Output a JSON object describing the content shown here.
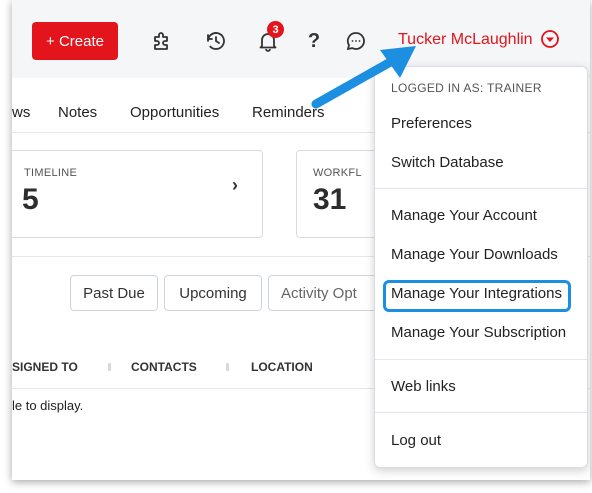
{
  "topbar": {
    "create_label": "+ Create",
    "icons": [
      "puzzle-icon",
      "history-icon",
      "bell-icon",
      "help-icon",
      "chat-icon"
    ],
    "notification_count": "3",
    "help_glyph": "?",
    "user_name": "Tucker McLaughlin",
    "accent_color": "#e3141b"
  },
  "tabs": [
    "ws",
    "Notes",
    "Opportunities",
    "Reminders"
  ],
  "cards": [
    {
      "label": "TIMELINE",
      "value": "5",
      "arrow": "›"
    },
    {
      "label": "WORKFL",
      "value": "31"
    }
  ],
  "filters": [
    "Past Due",
    "Upcoming",
    "Activity Opt"
  ],
  "table": {
    "columns": [
      "SIGNED TO",
      "CONTACTS",
      "LOCATION"
    ],
    "empty_message": "le to display."
  },
  "user_menu": {
    "heading": "LOGGED IN AS: TRAINER",
    "items": [
      "Preferences",
      "Switch Database",
      "Manage Your Account",
      "Manage Your Downloads",
      "Manage Your Integrations",
      "Manage Your Subscription",
      "Web links",
      "Log out"
    ],
    "highlighted_item": "Manage Your Integrations",
    "highlight_color": "#1c8fe0"
  }
}
